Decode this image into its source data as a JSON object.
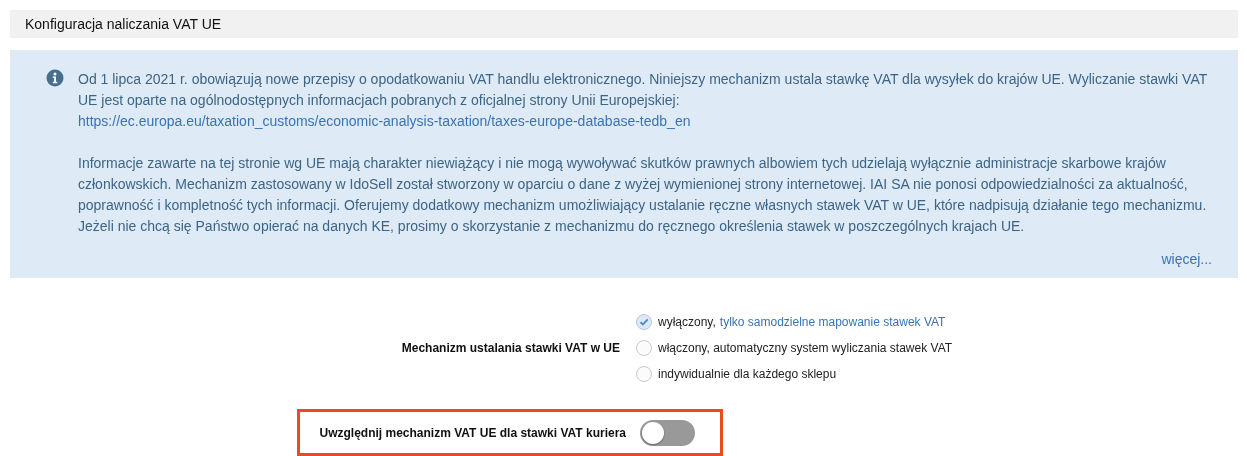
{
  "section": {
    "title": "Konfiguracja naliczania VAT UE"
  },
  "notice": {
    "paragraphs": [
      {
        "text": "Od 1 lipca 2021 r. obowiązują nowe przepisy o opodatkowaniu VAT handlu elektronicznego. Niniejszy mechanizm ustala stawkę VAT dla wysyłek do krajów UE. Wyliczanie stawki VAT UE jest oparte na ogólnodostępnych informacjach pobranych z oficjalnej strony Unii Europejskiej:",
        "link": "https://ec.europa.eu/taxation_customs/economic-analysis-taxation/taxes-europe-database-tedb_en"
      },
      {
        "text": "Informacje zawarte na tej stronie wg UE mają charakter niewiążący i nie mogą wywoływać skutków prawnych albowiem tych udzielają wyłącznie administracje skarbowe krajów członkowskich. Mechanizm zastosowany w IdoSell został stworzony w oparciu o dane z wyżej wymienionej strony internetowej. IAI SA nie ponosi odpowiedzialności za aktualność, poprawność i kompletność tych informacji. Oferujemy dodatkowy mechanizm umożliwiający ustalanie ręczne własnych stawek VAT w UE, które nadpisują działanie tego mechanizmu. Jeżeli nie chcą się Państwo opierać na danych KE, prosimy o skorzystanie z mechanizmu do ręcznego określenia stawek w poszczególnych krajach UE."
      }
    ],
    "more_link": "więcej..."
  },
  "mechanism": {
    "label": "Mechanizm ustalania stawki VAT w UE",
    "options": [
      {
        "label": "wyłączony,",
        "hint": "tylko samodzielne mapowanie stawek VAT",
        "selected": true
      },
      {
        "label": "włączony, automatyczny system wyliczania stawek VAT",
        "selected": false
      },
      {
        "label": "indywidualnie dla każdego sklepu",
        "selected": false
      }
    ]
  },
  "courier_toggle": {
    "label": "Uwzględnij mechanizm VAT UE dla stawki VAT kuriera",
    "on": false,
    "highlighted": true
  }
}
